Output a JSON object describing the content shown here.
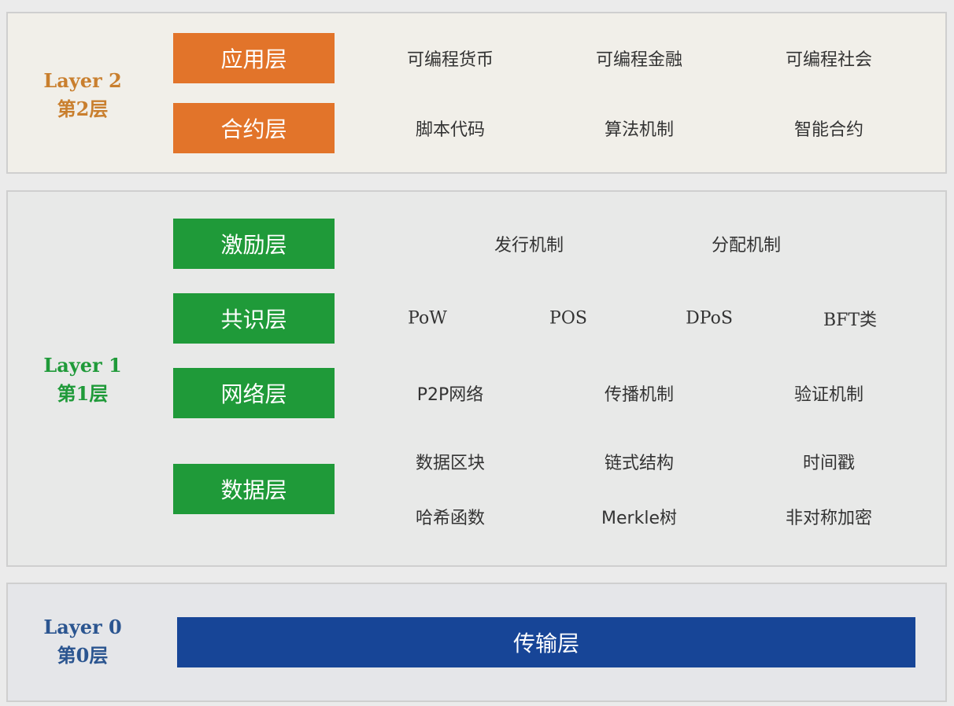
{
  "layer2": {
    "label": "Layer 2",
    "sub": "第2层",
    "color": "#e2742a",
    "rows": [
      {
        "name": "应用层",
        "items": [
          "可编程货币",
          "可编程金融",
          "可编程社会"
        ]
      },
      {
        "name": "合约层",
        "items": [
          "脚本代码",
          "算法机制",
          "智能合约"
        ]
      }
    ]
  },
  "layer1": {
    "label": "Layer 1",
    "sub": "第1层",
    "color": "#1f9a39",
    "rows": [
      {
        "name": "激励层",
        "items": [
          "发行机制",
          "分配机制"
        ]
      },
      {
        "name": "共识层",
        "items": [
          "PoW",
          "POS",
          "DPoS",
          "BFT类"
        ]
      },
      {
        "name": "网络层",
        "items": [
          "P2P网络",
          "传播机制",
          "验证机制"
        ]
      },
      {
        "name": "数据层",
        "items": [
          "数据区块",
          "链式结构",
          "时间戳",
          "哈希函数",
          "Merkle树",
          "非对称加密"
        ]
      }
    ]
  },
  "layer0": {
    "label": "Layer 0",
    "sub": "第0层",
    "color": "#174597",
    "name": "传输层"
  }
}
